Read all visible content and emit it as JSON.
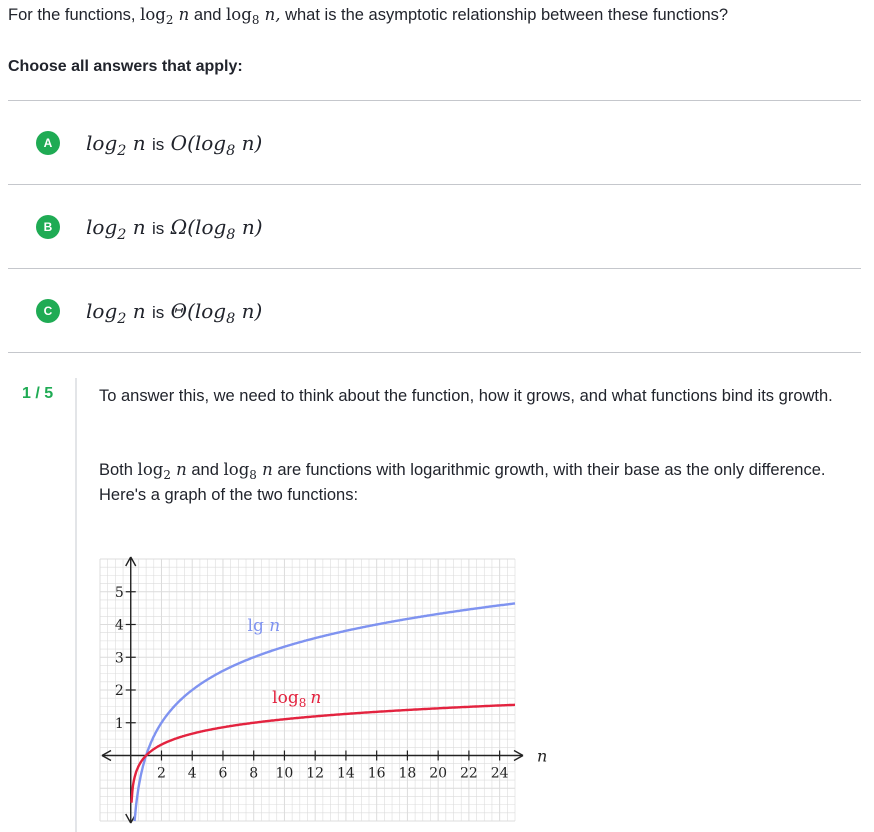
{
  "question": {
    "prefix": "For the functions,",
    "f1_log": "log",
    "f1_base": "2",
    "f1_arg": "n",
    "and": "and",
    "f2_log": "log",
    "f2_base": "8",
    "f2_arg": "n,",
    "suffix": "what is the asymptotic relationship between these functions?"
  },
  "instruction": "Choose all answers that apply:",
  "choices": [
    {
      "letter": "A",
      "log": "log",
      "base": "2",
      "n": "n",
      "is": "is",
      "rel": "O",
      "open": "(log",
      "base2": "8",
      "close": "n)"
    },
    {
      "letter": "B",
      "log": "log",
      "base": "2",
      "n": "n",
      "is": "is",
      "rel": "Ω",
      "open": "(log",
      "base2": "8",
      "close": "n)"
    },
    {
      "letter": "C",
      "log": "log",
      "base": "2",
      "n": "n",
      "is": "is",
      "rel": "Θ",
      "open": "(log",
      "base2": "8",
      "close": "n)"
    }
  ],
  "hint": {
    "counter": "1 / 5",
    "p1": "To answer this, we need to think about the function, how it grows, and what functions bind its growth.",
    "p2_prefix": "Both",
    "p2_log1": "log",
    "p2_base1": "2",
    "p2_n1": "n",
    "p2_and": "and",
    "p2_log2": "log",
    "p2_base2": "8",
    "p2_n2": "n",
    "p2_suffix": "are functions with logarithmic growth, with their base as the only difference. Here's a graph of the two functions:"
  },
  "colors": {
    "accent_green": "#1fab54",
    "lg_curve": "#7f93f0",
    "log8_curve": "#e3233f",
    "grid": "#dcdcdc",
    "text": "#21242c"
  },
  "chart_data": {
    "type": "line",
    "title": "",
    "xlabel": "n",
    "ylabel": "",
    "xlim": [
      -2,
      25
    ],
    "ylim": [
      -2,
      6
    ],
    "xticks": [
      "2",
      "4",
      "6",
      "8",
      "10",
      "12",
      "14",
      "16",
      "18",
      "20",
      "22",
      "24"
    ],
    "yticks": [
      "1",
      "2",
      "3",
      "4",
      "5"
    ],
    "grid": true,
    "series": [
      {
        "name": "lg n",
        "label_main": "lg",
        "label_var": "n",
        "color": "#7f93f0",
        "base": 2,
        "x": [
          0.25,
          0.5,
          1,
          2,
          4,
          8,
          12,
          16,
          20,
          24
        ],
        "y": [
          -2,
          -1,
          0,
          1,
          2,
          3,
          3.58,
          4,
          4.32,
          4.58
        ]
      },
      {
        "name": "log8 n",
        "label_main": "log",
        "label_sub": "8",
        "label_var": "n",
        "color": "#e3233f",
        "base": 8,
        "x": [
          0.05,
          0.25,
          1,
          2,
          4,
          8,
          12,
          16,
          20,
          24
        ],
        "y": [
          -1.44,
          -0.67,
          0,
          0.33,
          0.67,
          1,
          1.19,
          1.33,
          1.44,
          1.53
        ]
      }
    ]
  }
}
